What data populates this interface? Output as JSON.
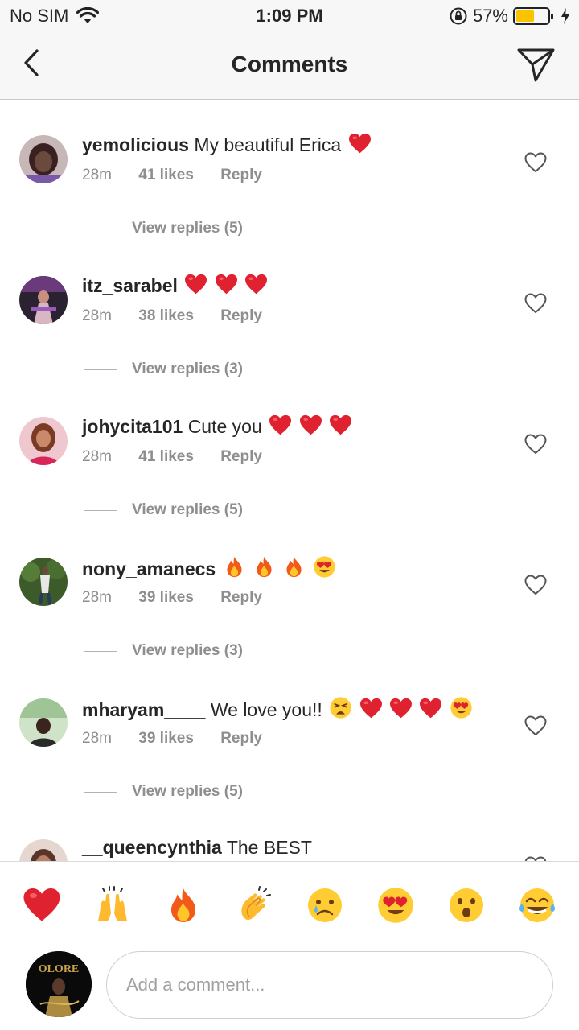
{
  "status_bar": {
    "carrier": "No SIM",
    "time": "1:09 PM",
    "battery_percent": "57%",
    "battery_level": 0.57
  },
  "nav": {
    "title": "Comments",
    "back_icon": "chevron-left-icon",
    "send_icon": "paper-plane-icon"
  },
  "comments": [
    {
      "username": "yemolicious",
      "text": "My beautiful Erica",
      "emojis": [
        "heart"
      ],
      "time": "28m",
      "likes": "41 likes",
      "reply": "Reply",
      "view_replies": "View replies (5)"
    },
    {
      "username": "itz_sarabel",
      "text": "",
      "emojis": [
        "heart",
        "heart",
        "heart"
      ],
      "time": "28m",
      "likes": "38 likes",
      "reply": "Reply",
      "view_replies": "View replies (3)"
    },
    {
      "username": "johycita101",
      "text": "Cute you",
      "emojis": [
        "heart",
        "heart",
        "heart"
      ],
      "time": "28m",
      "likes": "41 likes",
      "reply": "Reply",
      "view_replies": "View replies (5)"
    },
    {
      "username": "nony_amanecs",
      "text": "",
      "emojis": [
        "fire",
        "fire",
        "fire",
        "heart-eyes"
      ],
      "time": "28m",
      "likes": "39 likes",
      "reply": "Reply",
      "view_replies": "View replies (3)"
    },
    {
      "username": "mharyam____",
      "text": "We love you!!",
      "emojis": [
        "weary",
        "heart",
        "heart",
        "heart",
        "heart-eyes"
      ],
      "time": "28m",
      "likes": "39 likes",
      "reply": "Reply",
      "view_replies": "View replies (5)"
    },
    {
      "username": "__queencynthia",
      "text": "The BEST",
      "emojis": [],
      "time": "",
      "likes": "",
      "reply": "",
      "view_replies": ""
    }
  ],
  "reactions": [
    "heart",
    "raised-hands",
    "fire",
    "clapping-hands",
    "crying-face",
    "heart-eyes",
    "astonished-face",
    "tears-of-joy"
  ],
  "composer": {
    "placeholder": "Add a comment...",
    "avatar_text": "OLORE"
  },
  "colors": {
    "heart_red": "#e0212f",
    "meta_gray": "#8e8e8e",
    "battery_yellow": "#f8c400"
  }
}
